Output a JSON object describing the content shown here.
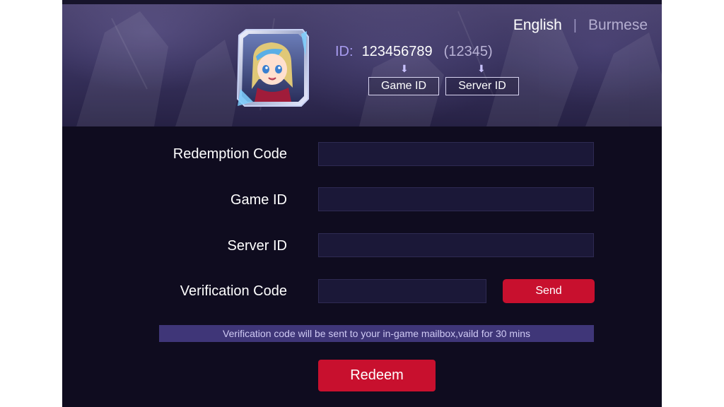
{
  "language": {
    "active": "English",
    "separator": "|",
    "inactive": "Burmese"
  },
  "header": {
    "id_label": "ID:",
    "game_id": "123456789",
    "server_id": "(12345)",
    "arrow": "⬇",
    "game_id_tag": "Game ID",
    "server_id_tag": "Server ID"
  },
  "form": {
    "redemption_code_label": "Redemption Code",
    "game_id_label": "Game ID",
    "server_id_label": "Server ID",
    "verification_code_label": "Verification Code",
    "redemption_code_value": "",
    "game_id_value": "",
    "server_id_value": "",
    "verification_code_value": "",
    "send_label": "Send",
    "notice": "Verification code will be sent to your in-game mailbox,vaild for 30 mins",
    "redeem_label": "Redeem"
  },
  "colors": {
    "accent_red": "#c8102e",
    "panel_bg": "#0f0c1f",
    "notice_bg": "#3f3678",
    "id_label_purple": "#a89cf0"
  },
  "icons": {
    "avatar": "hero-avatar-portrait",
    "down_arrow": "down-arrow-icon"
  }
}
